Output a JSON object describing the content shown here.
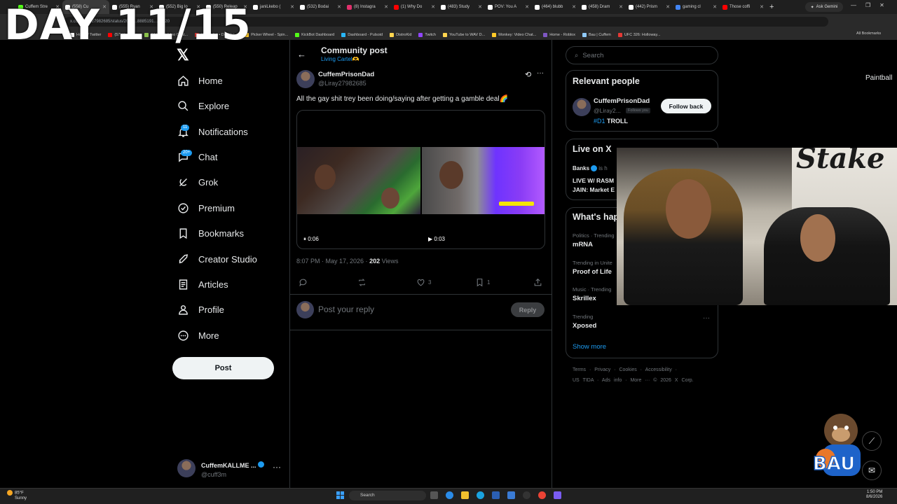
{
  "overlay": {
    "day": "DAY 11/15"
  },
  "browser": {
    "tabs": [
      {
        "label": "Cuffem Stre",
        "color": "#53fc18"
      },
      {
        "label": "(558) Cu",
        "color": "#ffffff",
        "active": true
      },
      {
        "label": "(555) Ryan",
        "color": "#ffffff"
      },
      {
        "label": "(552) Big lo",
        "color": "#ffffff"
      },
      {
        "label": "(550) Releap",
        "color": "#ffffff"
      },
      {
        "label": "janiLkebo (",
        "color": "#ffffff"
      },
      {
        "label": "(532) Bodai",
        "color": "#ffffff"
      },
      {
        "label": "(8) Instagra",
        "color": "#e1306c"
      },
      {
        "label": "(1) Why Do",
        "color": "#ff0000"
      },
      {
        "label": "(483) Study",
        "color": "#ffffff"
      },
      {
        "label": "POV: You A",
        "color": "#ffffff"
      },
      {
        "label": "(464) blubb",
        "color": "#ffffff"
      },
      {
        "label": "(458) Dram",
        "color": "#ffffff"
      },
      {
        "label": "(442) Prism",
        "color": "#ffffff"
      },
      {
        "label": "gaming cl",
        "color": "#4285f4"
      },
      {
        "label": "Those coffi",
        "color": "#ff0000"
      }
    ],
    "new_tab": "+",
    "gemini": "Ask Gemini",
    "url": "x.com/Liray27982685/status/2056…8885191…?s=20",
    "bookmarks": [
      {
        "label": "Home / Twitter",
        "color": "#ffffff"
      },
      {
        "label": "(57) YouTube",
        "color": "#ff0000"
      },
      {
        "label": "OMETV Video Chat...",
        "color": "#8bc34a"
      },
      {
        "label": "IRLToolkit • Dashbo...",
        "color": "#e53935"
      },
      {
        "label": "Picker Wheel - Spin...",
        "color": "#ffca28"
      },
      {
        "label": "KickBot Dashboard",
        "color": "#53fc18"
      },
      {
        "label": "Dashboard - Pulsoid",
        "color": "#29b6f6"
      },
      {
        "label": "DistroKid",
        "color": "#ffd54f"
      },
      {
        "label": "Twitch",
        "color": "#9146ff"
      },
      {
        "label": "YouTube to WAV D...",
        "color": "#ffd54f"
      },
      {
        "label": "Monkey: Video Chat...",
        "color": "#ffca28"
      },
      {
        "label": "Home - Roblox",
        "color": "#7e57c2"
      },
      {
        "label": "Bau | Cuffem",
        "color": "#90caf9"
      },
      {
        "label": "UFC 326: Holloway...",
        "color": "#e53935"
      }
    ],
    "all_bookmarks": "All Bookmarks"
  },
  "nav": {
    "logo": "𝕏",
    "items": [
      {
        "label": "Home",
        "icon": "home-icon"
      },
      {
        "label": "Explore",
        "icon": "search-icon"
      },
      {
        "label": "Notifications",
        "icon": "bell-icon",
        "badge": "11"
      },
      {
        "label": "Chat",
        "icon": "chat-icon",
        "badge": "20+"
      },
      {
        "label": "Grok",
        "icon": "grok-icon"
      },
      {
        "label": "Premium",
        "icon": "premium-icon"
      },
      {
        "label": "Bookmarks",
        "icon": "bookmark-icon"
      },
      {
        "label": "Creator Studio",
        "icon": "rocket-icon"
      },
      {
        "label": "Articles",
        "icon": "article-icon"
      },
      {
        "label": "Profile",
        "icon": "person-icon"
      },
      {
        "label": "More",
        "icon": "more-circle-icon"
      }
    ],
    "post_button": "Post",
    "account": {
      "name": "CuffemKALLME ...",
      "handle": "@cuff3m",
      "more": "···"
    }
  },
  "post": {
    "header_title": "Community post",
    "header_sub": "Living Cartel🫶",
    "author_name": "CuffemPrisonDad",
    "author_handle": "@Liray27982685",
    "text": "All the gay shit trey been doing/saying after getting a gamble deal🌈",
    "video1_duration": "0:06",
    "video2_duration": "0:03",
    "meta_time": "8:07 PM · May 17, 2026 · ",
    "meta_views": "202",
    "meta_views_label": " Views",
    "likes": "3",
    "bookmarks": "1",
    "reply_placeholder": "Post your reply",
    "reply_button": "Reply"
  },
  "right": {
    "search_placeholder": "Search",
    "relevant_title": "Relevant people",
    "rp_name": "CuffemPrisonDad",
    "rp_handle": "@Liray2...",
    "rp_follows_you": "Follows you",
    "rp_bio_tag": "#D1",
    "rp_bio_rest": " TROLL",
    "follow_back": "Follow back",
    "live_title": "Live on X",
    "live_host": "Banks",
    "live_host_suffix": " is h",
    "live_text": "LIVE W/ RASM JAIN: Market E",
    "wh_title": "What's hap",
    "trends": [
      {
        "category": "Politics · Trending",
        "name": "mRNA"
      },
      {
        "category": "Trending in Unite",
        "name": "Proof of Life"
      },
      {
        "category": "Music · Trending",
        "name": "Skrillex"
      },
      {
        "category": "Trending",
        "name": "Xposed"
      }
    ],
    "show_more": "Show more",
    "footer1": "Terms · Privacy · Cookies · Accessibility ·",
    "footer2": "US TIDA · Ads info · More ··· © 2026 X Corp."
  },
  "stream": {
    "paintball": "Paintball",
    "cam_logo": "Stake",
    "mascot_text": "BAU"
  },
  "taskbar": {
    "temp": "85°F",
    "weather": "Sunny",
    "search": "Search",
    "time": "1:50 PM",
    "date": "8/6/2026"
  }
}
